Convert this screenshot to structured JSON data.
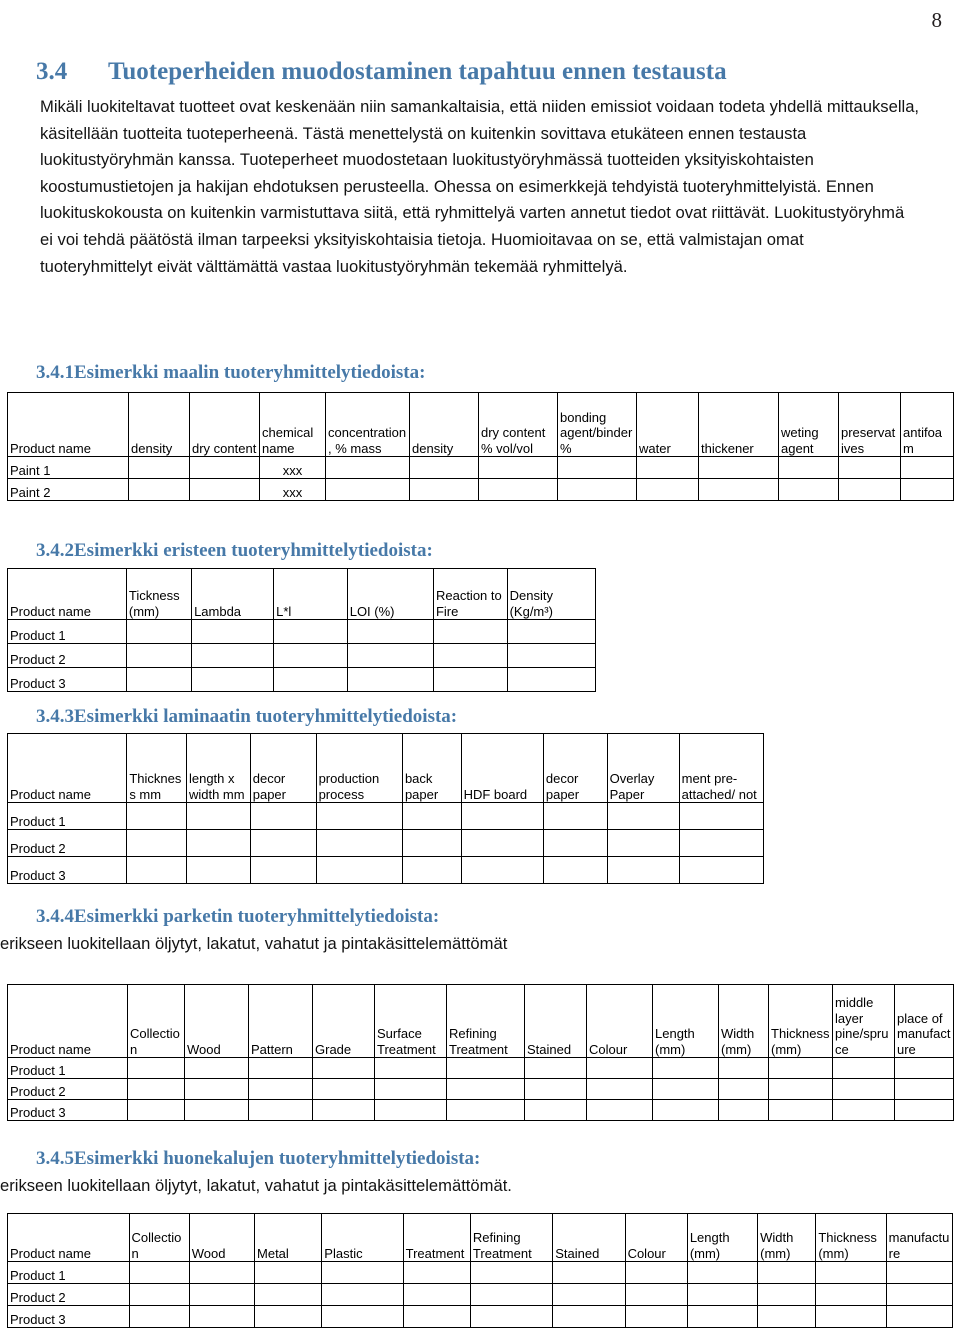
{
  "page": {
    "number": "8"
  },
  "section": {
    "number": "3.4",
    "title": "Tuoteperheiden muodostaminen tapahtuu ennen testausta",
    "paragraph": "Mikäli luokiteltavat tuotteet ovat keskenään niin samankaltaisia, että niiden emissiot voidaan todeta yhdellä mittauksella, käsitellään tuotteita tuoteperheenä. Tästä menettelystä on kuitenkin sovittava etukäteen ennen testausta luokitustyöryhmän kanssa. Tuoteperheet muodostetaan luokitustyöryhmässä tuotteiden yksityiskohtaisten koostumustietojen ja hakijan ehdotuksen perusteella. Ohessa on esimerkkejä tehdyistä tuoteryhmittelyistä. Ennen luokituskokousta on kuitenkin varmistuttava siitä, että ryhmittelyä varten annetut tiedot ovat riittävät. Luokitustyöryhmä ei voi tehdä päätöstä ilman tarpeeksi yksityiskohtaisia tietoja.  Huomioitavaa on se, että valmistajan omat tuoteryhmittelyt eivät välttämättä vastaa luokitustyöryhmän tekemää ryhmittelyä."
  },
  "subsections": {
    "paint": {
      "number": "3.4.1",
      "title": "Esimerkki maalin tuoteryhmittelytiedoista:",
      "table": {
        "headers": [
          "Product name",
          "density",
          "dry content",
          "chemical name",
          "concentration, % mass",
          "density",
          "dry content % vol/vol",
          "bonding agent/binder %",
          "water",
          "thickener",
          "weting agent",
          "preservatives",
          "antifoam"
        ],
        "rows": [
          [
            "Paint 1",
            "",
            "",
            "xxx",
            "",
            "",
            "",
            "",
            "",
            "",
            "",
            "",
            ""
          ],
          [
            "Paint 2",
            "",
            "",
            "xxx",
            "",
            "",
            "",
            "",
            "",
            "",
            "",
            "",
            ""
          ]
        ]
      }
    },
    "insulation": {
      "number": "3.4.2",
      "title": "Esimerkki eristeen tuoteryhmittelytiedoista:",
      "table": {
        "headers": [
          "Product name",
          "Tickness (mm)",
          "Lambda",
          "L*l",
          "LOI (%)",
          "Reaction to Fire",
          "Density (Kg/m³)"
        ],
        "rows": [
          [
            "Product 1",
            "",
            "",
            "",
            "",
            "",
            ""
          ],
          [
            "Product 2",
            "",
            "",
            "",
            "",
            "",
            ""
          ],
          [
            "Product 3",
            "",
            "",
            "",
            "",
            "",
            ""
          ]
        ]
      }
    },
    "laminate": {
      "number": "3.4.3",
      "title": "Esimerkki laminaatin tuoteryhmittelytiedoista:",
      "table": {
        "headers": [
          "Product name",
          "Thickness mm",
          "length x width mm",
          "decor paper",
          "production process",
          "back paper",
          "HDF board",
          "decor paper",
          "Overlay Paper",
          "ment pre-attached/ not"
        ],
        "rows": [
          [
            "Product 1",
            "",
            "",
            "",
            "",
            "",
            "",
            "",
            "",
            ""
          ],
          [
            "Product 2",
            "",
            "",
            "",
            "",
            "",
            "",
            "",
            "",
            ""
          ],
          [
            "Product 3",
            "",
            "",
            "",
            "",
            "",
            "",
            "",
            "",
            ""
          ]
        ]
      }
    },
    "parquet": {
      "number": "3.4.4",
      "title": "Esimerkki parketin tuoteryhmittelytiedoista:",
      "note": "erikseen luokitellaan öljytyt, lakatut, vahatut ja pintakäsittelemättömät",
      "table": {
        "headers": [
          "Product name",
          "Collection",
          "Wood",
          "Pattern",
          "Grade",
          "Surface Treatment",
          "Refining Treatment",
          "Stained",
          "Colour",
          "Length (mm)",
          "Width (mm)",
          "Thickness (mm)",
          "middle layer pine/spruce",
          "place of manufacture"
        ],
        "rows": [
          [
            "Product 1",
            "",
            "",
            "",
            "",
            "",
            "",
            "",
            "",
            "",
            "",
            "",
            "",
            ""
          ],
          [
            "Product 2",
            "",
            "",
            "",
            "",
            "",
            "",
            "",
            "",
            "",
            "",
            "",
            "",
            ""
          ],
          [
            "Product 3",
            "",
            "",
            "",
            "",
            "",
            "",
            "",
            "",
            "",
            "",
            "",
            "",
            ""
          ]
        ]
      }
    },
    "furniture": {
      "number": "3.4.5",
      "title": "Esimerkki huonekalujen tuoteryhmittelytiedoista:",
      "note": "erikseen luokitellaan öljytyt, lakatut, vahatut ja pintakäsittelemättömät.",
      "table": {
        "headers": [
          "Product name",
          "Collection",
          "Wood",
          "Metal",
          "Plastic",
          "Treatment",
          "Refining Treatment",
          "Stained",
          "Colour",
          "Length (mm)",
          "Width (mm)",
          "Thickness (mm)",
          "manufacture"
        ],
        "rows": [
          [
            "Product 1",
            "",
            "",
            "",
            "",
            "",
            "",
            "",
            "",
            "",
            "",
            "",
            ""
          ],
          [
            "Product 2",
            "",
            "",
            "",
            "",
            "",
            "",
            "",
            "",
            "",
            "",
            "",
            ""
          ],
          [
            "Product 3",
            "",
            "",
            "",
            "",
            "",
            "",
            "",
            "",
            "",
            "",
            "",
            ""
          ]
        ]
      }
    }
  },
  "colors": {
    "heading": "#4779A8",
    "text": "#131313",
    "border": "#000000"
  }
}
